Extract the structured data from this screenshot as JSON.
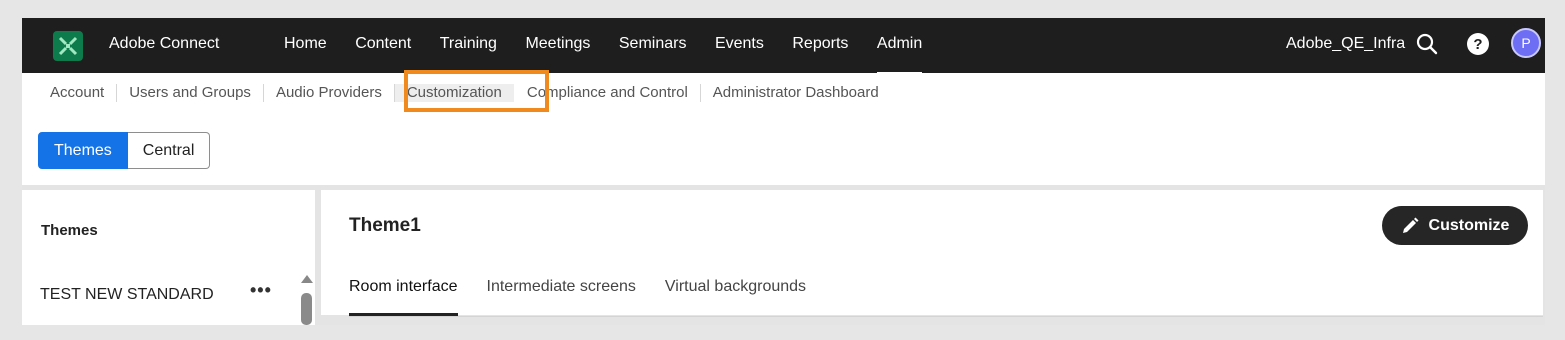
{
  "topnav": {
    "brand": "Adobe Connect",
    "logo_icon": "adobe-connect-logo",
    "items": [
      {
        "label": "Home"
      },
      {
        "label": "Content"
      },
      {
        "label": "Training"
      },
      {
        "label": "Meetings"
      },
      {
        "label": "Seminars"
      },
      {
        "label": "Events"
      },
      {
        "label": "Reports"
      },
      {
        "label": "Admin",
        "active": true
      }
    ],
    "user": "Adobe_QE_Infra",
    "avatar_initial": "P",
    "help_glyph": "?"
  },
  "subnav": {
    "items": [
      {
        "label": "Account"
      },
      {
        "label": "Users and Groups"
      },
      {
        "label": "Audio Providers"
      },
      {
        "label": "Customization",
        "highlighted": true
      },
      {
        "label": "Compliance and Control"
      },
      {
        "label": "Administrator Dashboard"
      }
    ]
  },
  "segment": {
    "themes": "Themes",
    "central": "Central"
  },
  "left_panel": {
    "title": "Themes",
    "items": [
      {
        "label": "TEST NEW STANDARD",
        "menu": "•••"
      }
    ]
  },
  "main": {
    "title": "Theme1",
    "customize_label": "Customize",
    "tabs": [
      {
        "label": "Room interface",
        "active": true
      },
      {
        "label": "Intermediate screens"
      },
      {
        "label": "Virtual backgrounds"
      }
    ]
  },
  "colors": {
    "topbar": "#1e1e1e",
    "accent_blue": "#1473e6",
    "highlight_orange": "#f08a1e",
    "avatar": "#6e6ef5"
  }
}
